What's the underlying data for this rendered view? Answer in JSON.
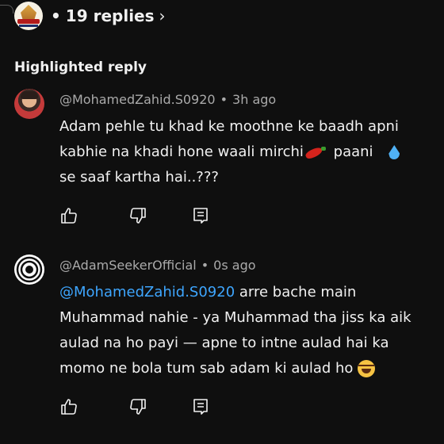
{
  "thread": {
    "replies_label": "19 replies",
    "bullet": "•",
    "chevron": "›"
  },
  "section_title": "Highlighted reply",
  "comments": [
    {
      "author": "@MohamedZahid.S0920",
      "separator": "•",
      "time": "3h ago",
      "lines": [
        "Adam pehle tu khad ke moothne ke baadh apni",
        "kabhie na khadi hone waali mirchi",
        " paani ",
        "se saaf kartha hai..???"
      ],
      "emoji": [
        "chili-emoji",
        "droplet-emoji"
      ]
    },
    {
      "author": "@AdamSeekerOfficial",
      "separator": "•",
      "time": "0s ago",
      "mention": "@MohamedZahid.S0920",
      "lines": [
        " arre bache main",
        "Muhammad nahie - ya Muhammad tha jiss ka aik",
        "aulad na ho payi — apne to intne aulad hai ka",
        "momo ne bola tum sab adam ki aulad ho "
      ],
      "emoji": [
        "tears-of-joy-emoji"
      ]
    }
  ],
  "actions": {
    "icons": [
      "thumbs-up-icon",
      "thumbs-down-icon",
      "reply-comment-icon"
    ]
  },
  "colors": {
    "background": "#0f0f0f",
    "text": "#f1f1f1",
    "meta": "#aaaaaa",
    "mention": "#3ea6ff"
  }
}
